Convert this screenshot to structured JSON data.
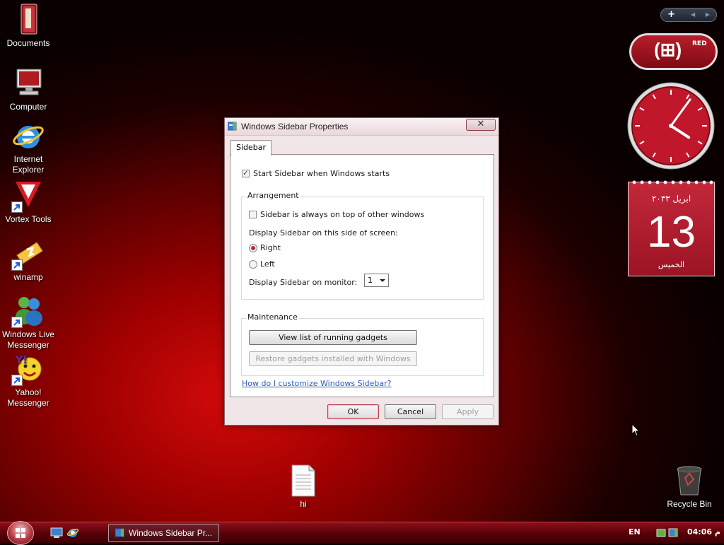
{
  "desktop": {
    "icons": [
      {
        "label": "Documents",
        "icon": "documents-folder-icon"
      },
      {
        "label": "Computer",
        "icon": "computer-icon"
      },
      {
        "label": "Internet Explorer",
        "icon": "internet-explorer-icon"
      },
      {
        "label": "Vortex Tools",
        "icon": "vortex-tools-icon"
      },
      {
        "label": "winamp",
        "icon": "winamp-icon"
      },
      {
        "label": "Windows Live Messenger",
        "icon": "windows-live-messenger-icon"
      },
      {
        "label": "Yahoo! Messenger",
        "icon": "yahoo-messenger-icon"
      },
      {
        "label": "hi",
        "icon": "text-file-icon"
      },
      {
        "label": "Recycle Bin",
        "icon": "recycle-bin-icon"
      }
    ]
  },
  "dialog": {
    "title": "Windows Sidebar Properties",
    "close_label": "✕",
    "tab": "Sidebar",
    "start_with_windows": {
      "label": "Start Sidebar when Windows starts",
      "checked": true
    },
    "arrangement": {
      "title": "Arrangement",
      "always_on_top": {
        "label": "Sidebar is always on top of other windows",
        "checked": false
      },
      "side_label": "Display Sidebar on this side of screen:",
      "options": [
        {
          "label": "Right",
          "selected": true
        },
        {
          "label": "Left",
          "selected": false
        }
      ],
      "monitor_label": "Display Sidebar on monitor:",
      "monitor_value": "1"
    },
    "maintenance": {
      "title": "Maintenance",
      "view_gadgets": "View list of running gadgets",
      "restore_gadgets": "Restore gadgets installed with Windows"
    },
    "help_link": "How do I customize Windows Sidebar?",
    "buttons": {
      "ok": "OK",
      "cancel": "Cancel",
      "apply": "Apply"
    }
  },
  "sidebar": {
    "add_label": "+",
    "nav_label": "◀ ▶",
    "brand_gadget": {
      "logo": "(⊞)",
      "tag": "RED"
    },
    "clock": {
      "hour": 4,
      "minute": 6
    },
    "calendar": {
      "month": "ابريل ٢٠٣٣",
      "day": "13",
      "weekday": "الخميس"
    }
  },
  "taskbar": {
    "task_button": "Windows Sidebar Pr...",
    "language": "EN",
    "time": "04:06 م"
  },
  "colors": {
    "accent": "#c8243a",
    "desktop": "#9d0000",
    "taskbar": "#560007"
  }
}
